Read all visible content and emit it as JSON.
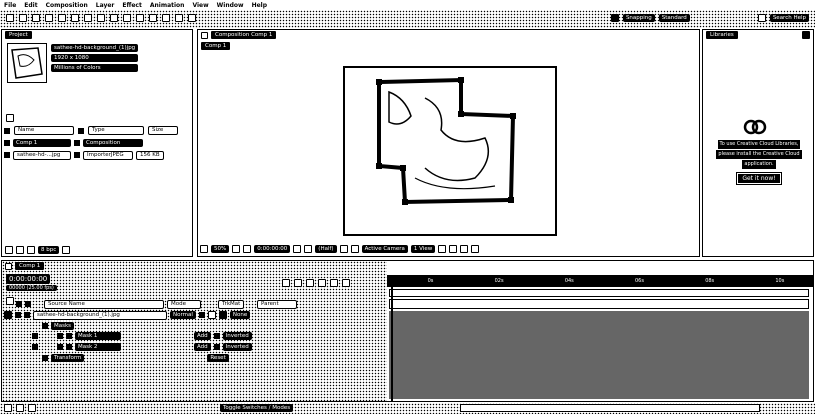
{
  "menu": [
    "File",
    "Edit",
    "Composition",
    "Layer",
    "Effect",
    "Animation",
    "View",
    "Window",
    "Help"
  ],
  "toolbar": {
    "snapping": "Snapping",
    "workspace": "Standard",
    "search_placeholder": "Search Help"
  },
  "project": {
    "tab": "Project",
    "file_name": "sathee-hd-background_(1)jpg",
    "file_dims": "1920 x 1080",
    "file_colors": "Millions of Colors",
    "search_icon": "search-icon",
    "columns": [
      "Name",
      "Type",
      "Size"
    ],
    "items": [
      {
        "name": "Comp 1",
        "type": "Composition",
        "size": ""
      },
      {
        "name": "sathee-hd-...jpg",
        "type": "ImporterJPEG",
        "size": "156 KB"
      }
    ],
    "bpc": "8 bpc"
  },
  "composition": {
    "tab": "Composition Comp 1",
    "subtab": "Comp 1",
    "zoom": "50%",
    "timecode": "0:00:00:00",
    "resolution": "(Half)",
    "camera": "Active Camera",
    "views": "1 View"
  },
  "libraries": {
    "tab": "Libraries",
    "msg1": "To use Creative Cloud Libraries,",
    "msg2": "please install the Creative Cloud",
    "msg3": "application.",
    "button": "Get it now!"
  },
  "timeline": {
    "tab": "Comp 1",
    "timecode": "0:00:00:00",
    "fps": "00000 (25.00 fps)",
    "col_source": "Source Name",
    "col_mode": "Mode",
    "col_trkmat": "TrkMat",
    "col_parent": "Parent",
    "layer_name": "sathee-hd-background_(1).jpg",
    "layer_mode": "Normal",
    "layer_parent": "None",
    "masks_label": "Masks",
    "mask1": "Mask 1",
    "mask2": "Mask 2",
    "mask_mode": "Add",
    "inverted": "Inverted",
    "transform": "Transform",
    "reset": "Reset",
    "ruler": [
      "0s",
      "02s",
      "04s",
      "06s",
      "08s",
      "10s"
    ],
    "toggle": "Toggle Switches / Modes"
  }
}
